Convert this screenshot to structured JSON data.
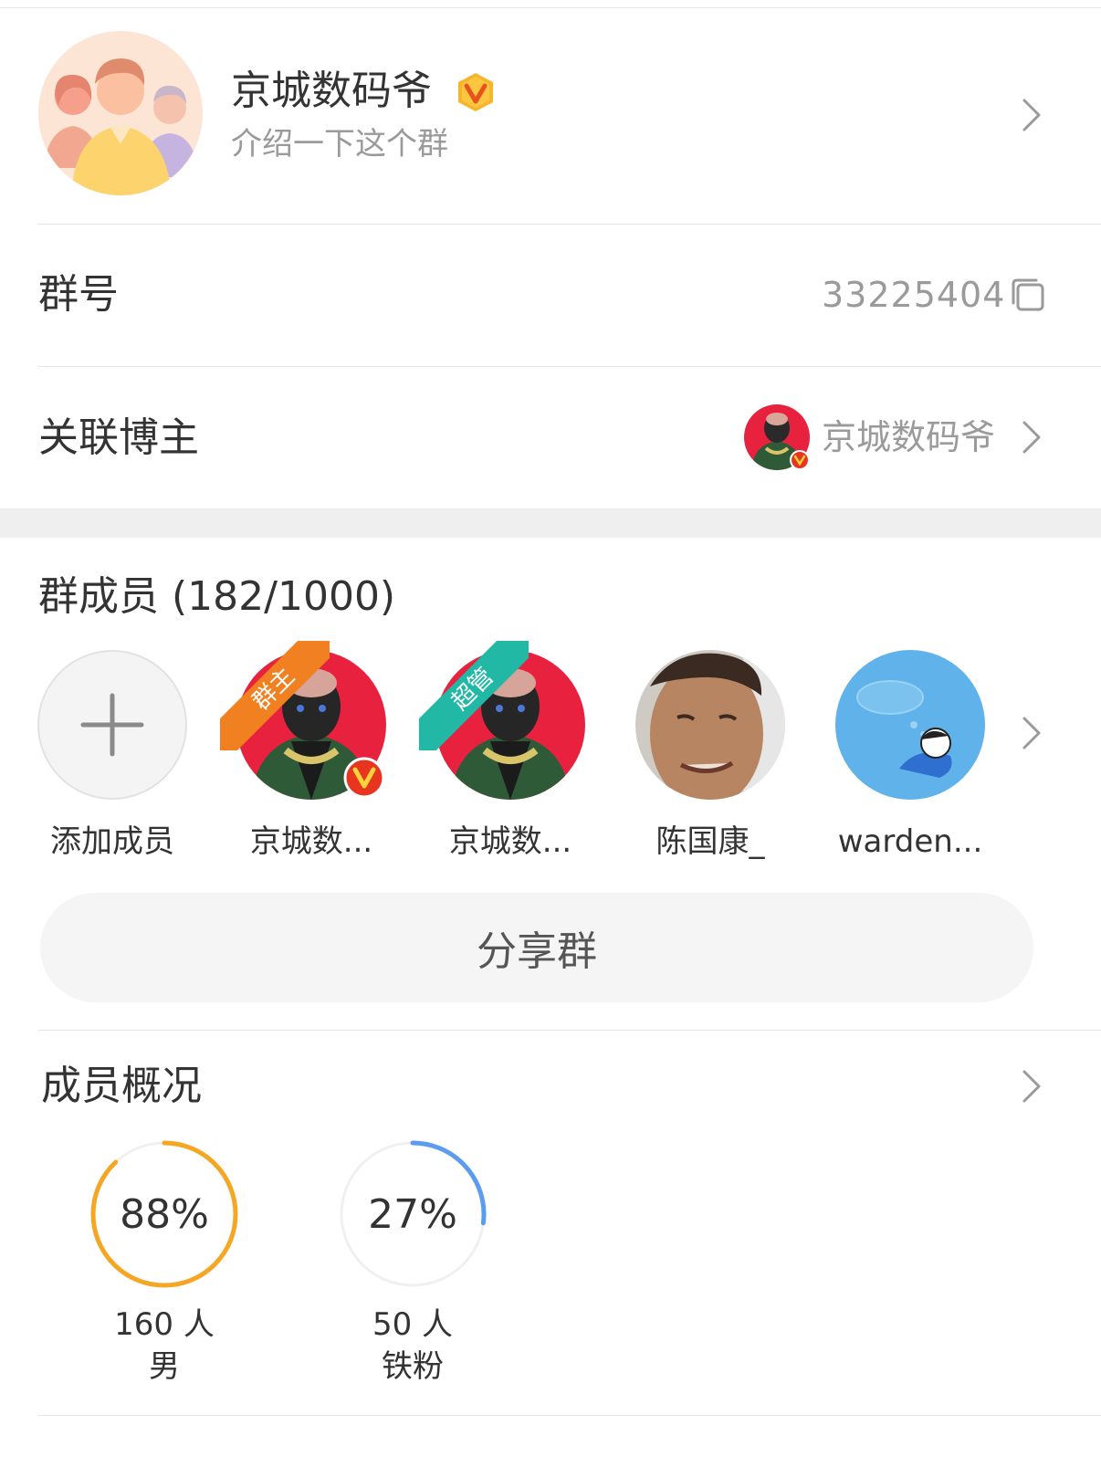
{
  "header": {
    "group_name": "京城数码爷",
    "verified_badge_icon": "vip-v-badge-icon",
    "description_placeholder": "介绍一下这个群"
  },
  "group_number": {
    "label": "群号",
    "value": "33225404",
    "copy_icon": "copy-icon"
  },
  "linked_blogger": {
    "label": "关联博主",
    "name": "京城数码爷"
  },
  "members": {
    "title": "群成员 (182/1000)",
    "items": [
      {
        "name": "添加成员",
        "icon": "plus-icon"
      },
      {
        "name": "京城数...",
        "ribbon": "群主",
        "ribbon_color": "#f08020"
      },
      {
        "name": "京城数...",
        "ribbon": "超管",
        "ribbon_color": "#21b8a6"
      },
      {
        "name": "陈国康_"
      },
      {
        "name": "warden..."
      }
    ],
    "share_button": "分享群"
  },
  "overview": {
    "title": "成员概况",
    "stats": [
      {
        "percent": "88%",
        "fraction": 0.88,
        "count": "160 人",
        "label": "男",
        "color": "#f5a623"
      },
      {
        "percent": "27%",
        "fraction": 0.27,
        "count": "50 人",
        "label": "铁粉",
        "color": "#5b9cf0"
      }
    ]
  },
  "colors": {
    "accent_orange": "#f5a623",
    "accent_blue": "#5b9cf0",
    "text_primary": "#333333",
    "text_secondary": "#9a9a9a"
  }
}
